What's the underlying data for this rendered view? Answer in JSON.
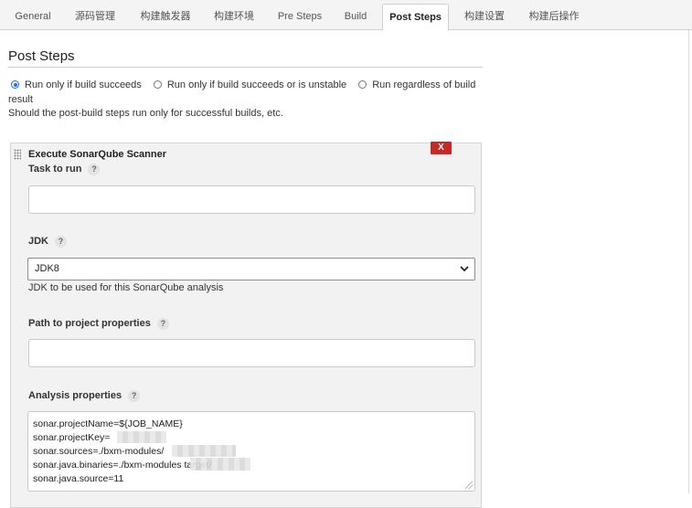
{
  "tabs": [
    {
      "label": "General",
      "active": false
    },
    {
      "label": "源码管理",
      "active": false
    },
    {
      "label": "构建触发器",
      "active": false
    },
    {
      "label": "构建环境",
      "active": false
    },
    {
      "label": "Pre Steps",
      "active": false
    },
    {
      "label": "Build",
      "active": false
    },
    {
      "label": "Post Steps",
      "active": true
    },
    {
      "label": "构建设置",
      "active": false
    },
    {
      "label": "构建后操作",
      "active": false
    }
  ],
  "section": {
    "title": "Post Steps",
    "radio_options": [
      {
        "label": "Run only if build succeeds",
        "checked": true
      },
      {
        "label": "Run only if build succeeds or is unstable",
        "checked": false
      },
      {
        "label": "Run regardless of build result",
        "checked": false
      }
    ],
    "help_text": "Should the post-build steps run only for successful builds, etc."
  },
  "builder": {
    "title": "Execute SonarQube Scanner",
    "delete_label": "X",
    "help_glyph": "?",
    "task_label": "Task to run",
    "task_value": "",
    "jdk_label": "JDK",
    "jdk_value": "JDK8",
    "jdk_description": "JDK to be used for this SonarQube analysis",
    "path_label": "Path to project properties",
    "path_value": "",
    "analysis_label": "Analysis properties",
    "analysis_lines": [
      "sonar.projectName=${JOB_NAME}",
      "sonar.projectKey=",
      "sonar.sources=./bxm-modules/",
      "sonar.java.binaries=./bxm-modules                    target/",
      "sonar.java.source=11"
    ]
  },
  "colors": {
    "accent": "#1a73e8",
    "delete": "#c62828"
  }
}
